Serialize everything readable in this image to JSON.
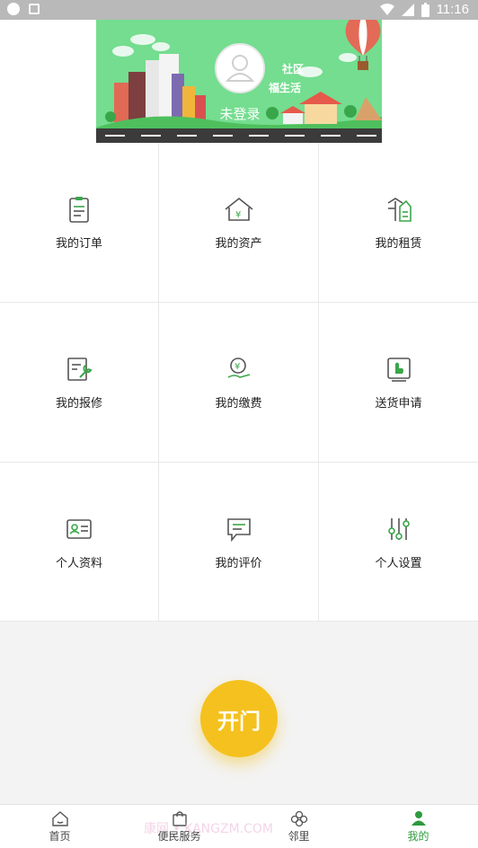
{
  "status_bar": {
    "time": "11:16"
  },
  "header": {
    "banner_text_1": "社区",
    "banner_text_2": "福生活",
    "login_label": "未登录"
  },
  "grid": [
    {
      "label": "我的订单",
      "icon": "clipboard-icon"
    },
    {
      "label": "我的资产",
      "icon": "house-yen-icon"
    },
    {
      "label": "我的租赁",
      "icon": "rent-building-icon"
    },
    {
      "label": "我的报修",
      "icon": "repair-wrench-icon"
    },
    {
      "label": "我的缴费",
      "icon": "payment-yen-icon"
    },
    {
      "label": "送货申请",
      "icon": "delivery-hand-icon"
    },
    {
      "label": "个人资料",
      "icon": "id-card-icon"
    },
    {
      "label": "我的评价",
      "icon": "comment-icon"
    },
    {
      "label": "个人设置",
      "icon": "sliders-icon"
    }
  ],
  "door_button": {
    "label": "开门"
  },
  "bottom_nav": [
    {
      "label": "首页",
      "icon": "home-icon",
      "active": false
    },
    {
      "label": "便民服务",
      "icon": "shopping-bag-icon",
      "active": false
    },
    {
      "label": "邻里",
      "icon": "clover-icon",
      "active": false
    },
    {
      "label": "我的",
      "icon": "user-icon",
      "active": true
    }
  ],
  "watermark": "康网 • KANGZM.COM",
  "colors": {
    "accent_green": "#2e9a3e",
    "banner_green": "#74dd8f",
    "door_yellow": "#f4c11f"
  }
}
